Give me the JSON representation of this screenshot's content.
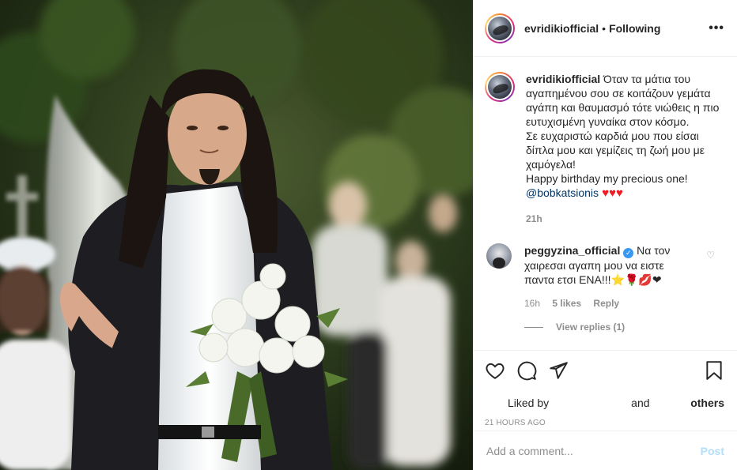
{
  "post": {
    "username": "evridikiofficial",
    "separator": "•",
    "follow_status": "Following",
    "more_label": "•••"
  },
  "caption": {
    "username": "evridikiofficial",
    "line1": " Όταν τα μάτια του αγαπημένου σου σε κοιτάζουν γεμάτα αγάπη και θαυμασμό τότε νιώθεις η πιο ευτυχισμένη γυναίκα στον κόσμο.",
    "line2": "Σε ευχαριστώ καρδιά μου που είσαι δίπλα μου και γεμίζεις τη ζωή μου με χαμόγελα!",
    "line3": "Happy birthday my precious one!",
    "mention": "@bobkatsionis",
    "hearts": " ♥♥♥",
    "time": "21h"
  },
  "comment": {
    "username": "peggyzina_official",
    "verified_mark": "✓",
    "text": " Να τον χαιρεσαι αγαπη μου να ειστε παντα ετσι ΕΝΑ!!!⭐🌹💋❤",
    "time": "16h",
    "likes": "5 likes",
    "reply": "Reply",
    "view_replies": "View replies (1)",
    "like_icon": "♡"
  },
  "likes": {
    "liked_by": "Liked by",
    "and": "and",
    "others": "others"
  },
  "timestamp": "21 hours ago",
  "add_comment": {
    "placeholder": "Add a comment...",
    "post_label": "Post"
  },
  "colors": {
    "link": "#00376b",
    "muted": "#8e8e8e",
    "verified": "#3897f0",
    "post_disabled": "#b2dffc",
    "heart": "#ed1c24"
  }
}
